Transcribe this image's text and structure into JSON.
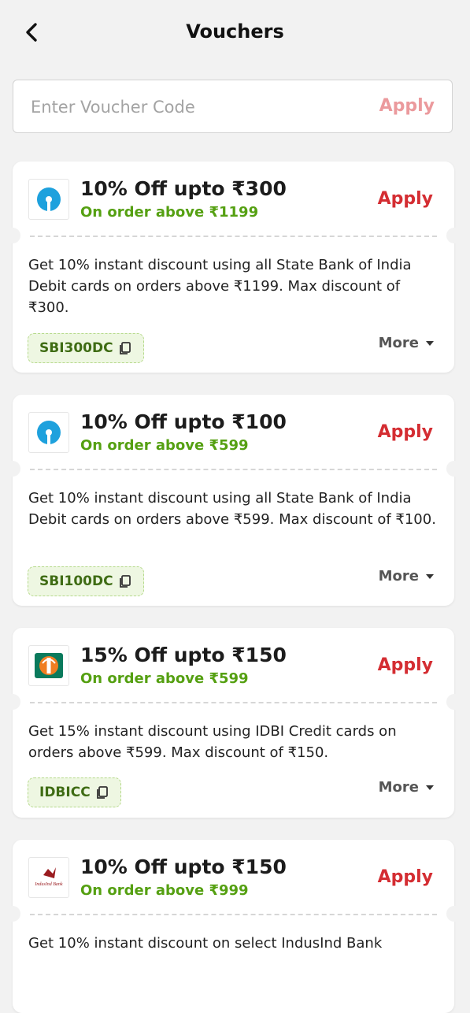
{
  "header": {
    "title": "Vouchers",
    "back_icon": "chevron-left-icon"
  },
  "search": {
    "placeholder": "Enter Voucher Code",
    "value": "",
    "apply_label": "Apply",
    "apply_color": "#eb9a9d"
  },
  "colors": {
    "accent": "#d42d32",
    "condition_green": "#55a012",
    "code_bg": "#eef7e2",
    "code_text": "#3f6c14",
    "page_bg": "#f2f2f2"
  },
  "vouchers": [
    {
      "logo": "sbi-logo",
      "title": "10% Off upto ₹300",
      "condition": "On order above ₹1199",
      "apply_label": "Apply",
      "description": "Get 10% instant discount using all State Bank of India Debit cards on orders above ₹1199. Max discount of ₹300.",
      "code": "SBI300DC",
      "more_label": "More"
    },
    {
      "logo": "sbi-logo",
      "title": "10% Off upto ₹100",
      "condition": "On order above ₹599",
      "apply_label": "Apply",
      "description": "Get 10% instant discount using all State Bank of India Debit cards on orders above ₹599. Max discount of ₹100.",
      "code": "SBI100DC",
      "more_label": "More"
    },
    {
      "logo": "idbi-logo",
      "title": "15% Off upto ₹150",
      "condition": "On order above ₹599",
      "apply_label": "Apply",
      "description": "Get 15% instant discount using IDBI Credit cards on orders above ₹599. Max discount of ₹150.",
      "code": "IDBICC",
      "more_label": "More"
    },
    {
      "logo": "indusind-logo",
      "logo_text": "IndusInd Bank",
      "title": "10% Off upto ₹150",
      "condition": "On order above ₹999",
      "apply_label": "Apply",
      "description": "Get 10% instant discount on select IndusInd Bank"
    }
  ]
}
